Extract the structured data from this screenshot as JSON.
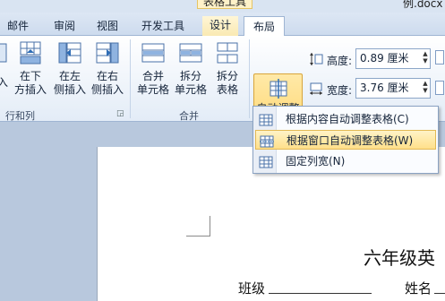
{
  "title_bar": {
    "context_tab_group": "表格工具",
    "document_name": "例.docx"
  },
  "tabs": [
    {
      "label": "邮件"
    },
    {
      "label": "审阅"
    },
    {
      "label": "视图"
    },
    {
      "label": "开发工具"
    },
    {
      "label": "设计"
    },
    {
      "label": "布局"
    }
  ],
  "ribbon": {
    "rows_cols": {
      "insert_below": {
        "line1": "在下",
        "line2": "方插入"
      },
      "insert_left": {
        "line1": "在左",
        "line2": "侧插入"
      },
      "insert_right": {
        "line1": "在右",
        "line2": "侧插入"
      },
      "partial_left": "入",
      "group_label": "行和列"
    },
    "merge": {
      "merge_cells": {
        "line1": "合并",
        "line2": "单元格"
      },
      "split_cells": {
        "line1": "拆分",
        "line2": "单元格"
      },
      "split_table": {
        "line1": "拆分",
        "line2": "表格"
      },
      "group_label": "合并"
    },
    "autofit": {
      "label": "自动调整"
    },
    "height": {
      "label": "高度:",
      "value": "0.89 厘米"
    },
    "width": {
      "label": "宽度:",
      "value": "3.76 厘米"
    }
  },
  "autofit_menu": {
    "items": [
      {
        "label": "根据内容自动调整表格(C)",
        "highlighted": false
      },
      {
        "label": "根据窗口自动调整表格(W)",
        "highlighted": true
      },
      {
        "label": "固定列宽(N)",
        "highlighted": false
      }
    ]
  },
  "document": {
    "title": "六年级英",
    "class_label": "班级",
    "name_label": "姓名"
  },
  "colors": {
    "highlight": "#ffe08a",
    "ribbon_bg": "#e3ecf7",
    "doc_bg": "#b8c8dd"
  }
}
